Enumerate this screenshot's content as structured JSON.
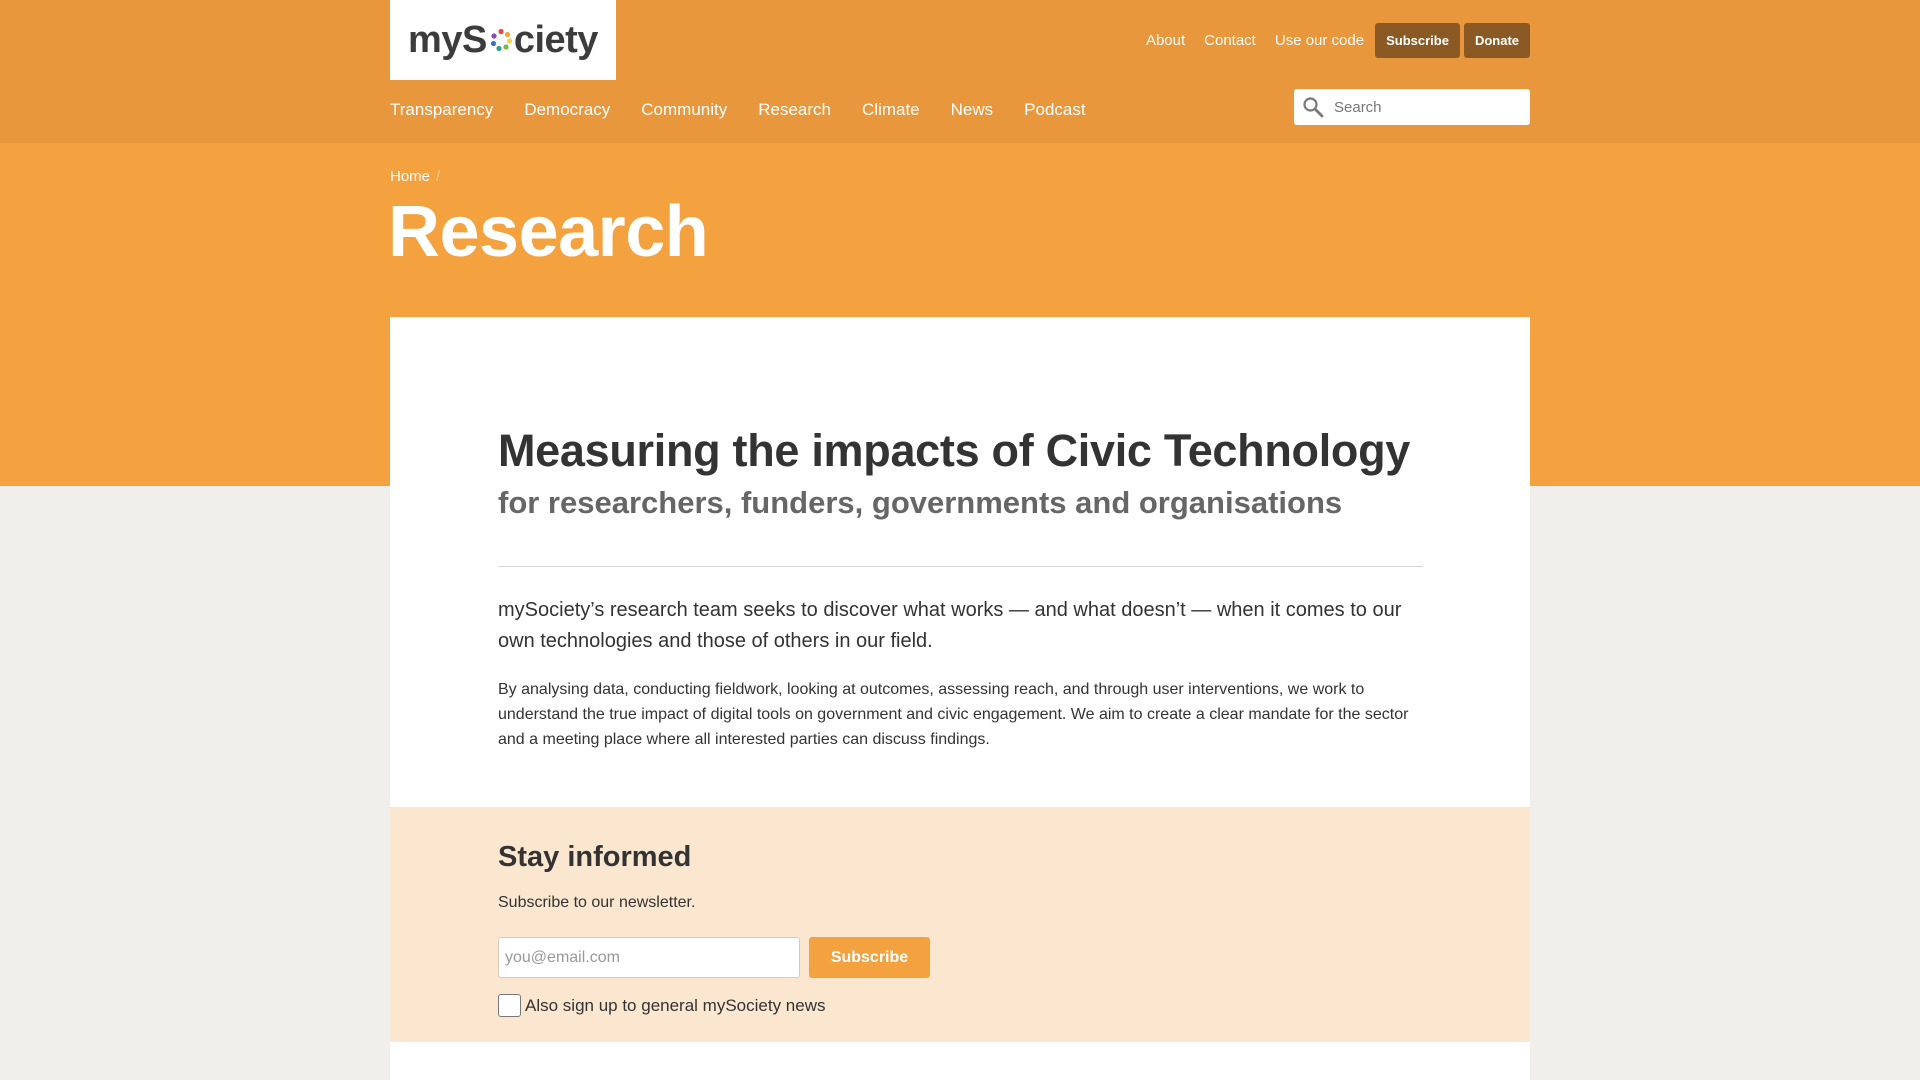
{
  "brand": {
    "logo_text_before": "myS",
    "logo_text_after": "ciety",
    "colors": {
      "header_bg": "#e8973c",
      "hero_bg": "#f4a23f",
      "button_dark": "#8b5a24",
      "newsletter_bg": "#fbe7cf",
      "page_bg": "#f1efeb"
    }
  },
  "header": {
    "top_links": [
      "About",
      "Contact",
      "Use our code"
    ],
    "subscribe_label": "Subscribe",
    "donate_label": "Donate",
    "nav": [
      "Transparency",
      "Democracy",
      "Community",
      "Research",
      "Climate",
      "News",
      "Podcast"
    ],
    "search": {
      "placeholder": "Search",
      "icon": "search-icon"
    }
  },
  "hero": {
    "breadcrumb": {
      "home": "Home",
      "separator": "/"
    },
    "title": "Research"
  },
  "article": {
    "heading": "Measuring the impacts of Civic Technology",
    "subheading": "for researchers, funders, governments and organisations",
    "lede": "mySociety’s research team seeks to discover what works — and what doesn’t — when it comes to our own technologies and those of others in our field.",
    "body": "By analysing data, conducting fieldwork, looking at outcomes, assessing reach, and through user interventions, we work to understand the true impact of digital tools on government and civic engagement. We aim to create a clear mandate for the sector and a meeting place where all interested parties can discuss findings."
  },
  "newsletter": {
    "title": "Stay informed",
    "text": "Subscribe to our newsletter.",
    "email_placeholder": "you@email.com",
    "submit_label": "Subscribe",
    "checkbox_label": "Also sign up to general mySociety news",
    "checkbox_checked": false
  }
}
